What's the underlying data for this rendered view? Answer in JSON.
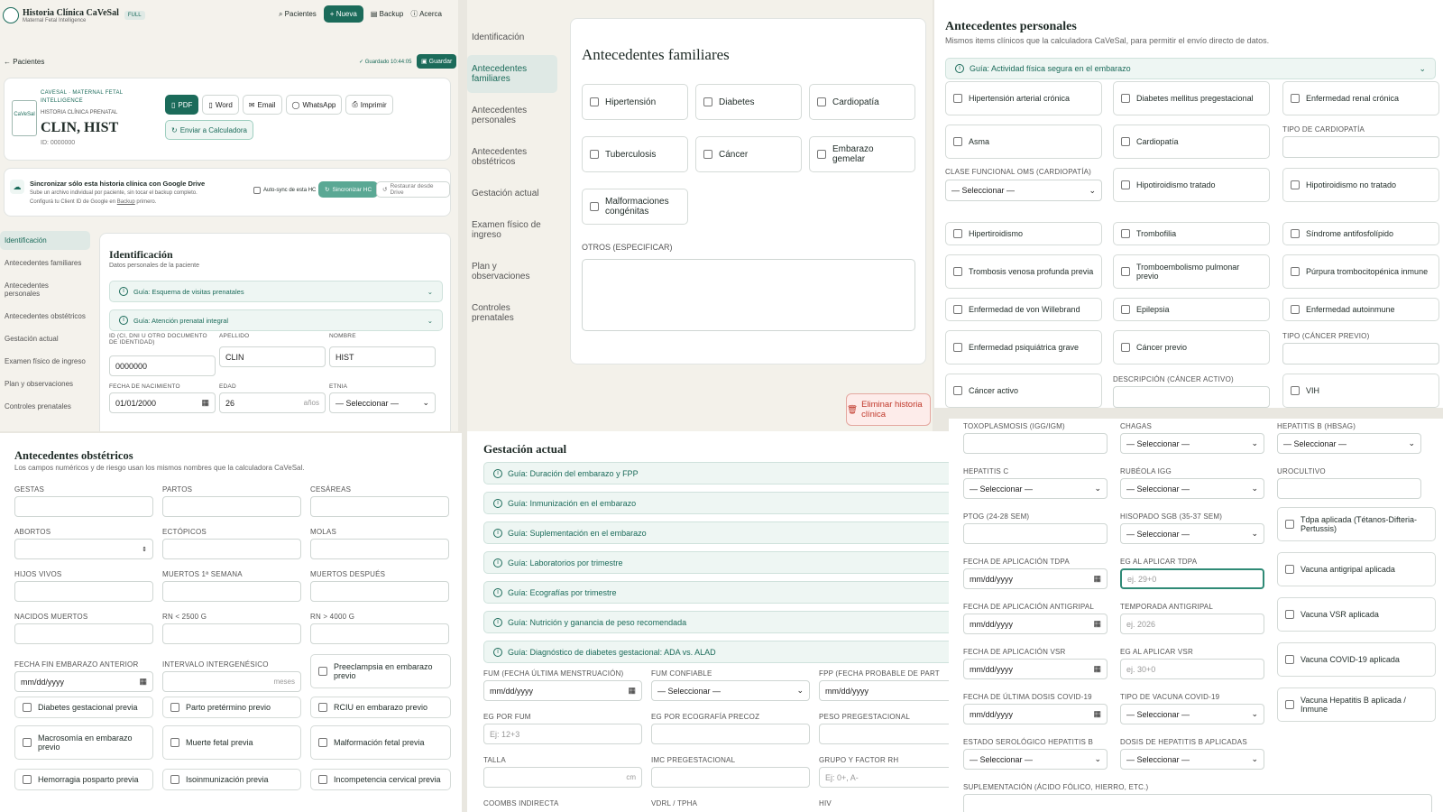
{
  "app": {
    "title": "Historia Clínica CaVeSal",
    "subtitle": "Maternal Fetal Intelligence",
    "badge": "FULL",
    "nav_pacientes": "Pacientes",
    "nav_nueva": "+ Nueva",
    "nav_backup": "Backup",
    "nav_acerca": "Acerca"
  },
  "p1": {
    "back": "Pacientes",
    "saved": "✓ Guardado 10:44:05",
    "save_btn": "Guardar",
    "card": {
      "org": "CAVESAL · MATERNAL FETAL INTELLIGENCE",
      "doc": "HISTORIA CLÍNICA PRENATAL",
      "name": "CLIN, HIST",
      "id": "ID: 0000000",
      "btn_pdf": "PDF",
      "btn_word": "Word",
      "btn_email": "Email",
      "btn_whatsapp": "WhatsApp",
      "btn_print": "Imprimir",
      "btn_send": "Enviar a Calculadora"
    },
    "sync": {
      "title": "Sincronizar sólo esta historia clínica con Google Drive",
      "desc": "Sube un archivo individual por paciente, sin tocar el backup completo.",
      "desc2a": "Configurá tu Client ID de Google en ",
      "desc2link": "Backup",
      "desc2b": " primero.",
      "autosync": "Auto-sync de esta HC",
      "sync_btn": "Sincronizar HC",
      "restore_btn": "Restaurar desde Drive"
    },
    "sidebar": [
      "Identificación",
      "Antecedentes familiares",
      "Antecedentes personales",
      "Antecedentes obstétricos",
      "Gestación actual",
      "Examen físico de ingreso",
      "Plan y observaciones",
      "Controles prenatales"
    ],
    "ident": {
      "title": "Identificación",
      "subtitle": "Datos personales de la paciente",
      "guide1": "Guía: Esquema de visitas prenatales",
      "guide2": "Guía: Atención prenatal integral",
      "id_label": "ID (CI, DNI U OTRO DOCUMENTO DE IDENTIDAD)",
      "id_value": "0000000",
      "apellido_label": "APELLIDO",
      "apellido_value": "CLIN",
      "nombre_label": "NOMBRE",
      "nombre_value": "HIST",
      "fnac_label": "FECHA DE NACIMIENTO",
      "fnac_value": "01/01/2000",
      "edad_label": "EDAD",
      "edad_value": "26",
      "edad_suffix": "años",
      "etnia_label": "ETNIA",
      "etnia_value": "— Seleccionar —"
    }
  },
  "p2": {
    "sidebar": [
      "Identificación",
      "Antecedentes familiares",
      "Antecedentes personales",
      "Antecedentes obstétricos",
      "Gestación actual",
      "Examen físico de ingreso",
      "Plan y observaciones",
      "Controles prenatales"
    ],
    "title": "Antecedentes familiares",
    "items": [
      "Hipertensión",
      "Diabetes",
      "Cardiopatía",
      "Tuberculosis",
      "Cáncer",
      "Embarazo gemelar",
      "Malformaciones congénitas"
    ],
    "otros_label": "OTROS (ESPECIFICAR)",
    "delete_btn": "Eliminar historia clínica"
  },
  "p3": {
    "title": "Antecedentes personales",
    "subtitle": "Mismos items clínicos que la calculadora CaVeSal, para permitir el envío directo de datos.",
    "guide": "Guía: Actividad física segura en el embarazo",
    "r1": [
      "Hipertensión arterial crónica",
      "Diabetes mellitus pregestacional",
      "Enfermedad renal crónica"
    ],
    "asma": "Asma",
    "cardiopatia": "Cardiopatía",
    "tipo_cardio_label": "TIPO DE CARDIOPATÍA",
    "clase_label": "CLASE FUNCIONAL OMS (CARDIOPATÍA)",
    "clase_value": "— Seleccionar —",
    "hipo_tratado": "Hipotiroidismo tratado",
    "hipo_no_tratado": "Hipotiroidismo no tratado",
    "r4": [
      "Hipertiroidismo",
      "Trombofilia",
      "Síndrome antifosfolípido"
    ],
    "r5": [
      "Trombosis venosa profunda previa",
      "Tromboembolismo pulmonar previo",
      "Púrpura trombocitopénica inmune"
    ],
    "r6": [
      "Enfermedad de von Willebrand",
      "Epilepsia",
      "Enfermedad autoinmune"
    ],
    "psiq": "Enfermedad psiquiátrica grave",
    "cancer_previo": "Cáncer previo",
    "tipo_cancer_label": "TIPO (CÁNCER PREVIO)",
    "cancer_activo": "Cáncer activo",
    "desc_cancer_label": "DESCRIPCIÓN (CÁNCER ACTIVO)",
    "vih": "VIH"
  },
  "p4": {
    "title": "Antecedentes obstétricos",
    "subtitle": "Los campos numéricos y de riesgo usan los mismos nombres que la calculadora CaVeSal.",
    "fields": [
      "GESTAS",
      "PARTOS",
      "CESÁREAS",
      "ABORTOS",
      "ECTÓPICOS",
      "MOLAS",
      "HIJOS VIVOS",
      "MUERTOS 1ª SEMANA",
      "MUERTOS DESPUÉS",
      "NACIDOS MUERTOS",
      "RN < 2500 G",
      "RN > 4000 G"
    ],
    "fecha_fin_label": "FECHA FIN EMBARAZO ANTERIOR",
    "fecha_fin_value": "mm/dd/yyyy",
    "intervalo_label": "INTERVALO INTERGENÉSICO",
    "intervalo_suffix": "meses",
    "preeclampsia": "Preeclampsia en embarazo previo",
    "c1": [
      "Diabetes gestacional previa",
      "Parto pretérmino previo",
      "RCIU en embarazo previo"
    ],
    "c2": [
      "Macrosomía en embarazo previo",
      "Muerte fetal previa",
      "Malformación fetal previa"
    ],
    "c3": [
      "Hemorragia posparto previa",
      "Isoinmunización previa",
      "Incompetencia cervical previa"
    ]
  },
  "p5": {
    "title": "Gestación actual",
    "guides": [
      "Guía: Duración del embarazo y FPP",
      "Guía: Inmunización en el embarazo",
      "Guía: Suplementación en el embarazo",
      "Guía: Laboratorios por trimestre",
      "Guía: Ecografías por trimestre",
      "Guía: Nutrición y ganancia de peso recomendada",
      "Guía: Diagnóstico de diabetes gestacional: ADA vs. ALAD"
    ],
    "fum_label": "FUM (FECHA ÚLTIMA MENSTRUACIÓN)",
    "fum_value": "mm/dd/yyyy",
    "fumc_label": "FUM CONFIABLE",
    "fumc_value": "— Seleccionar —",
    "fpp_label": "FPP (FECHA PROBABLE DE PART",
    "fpp_value": "mm/dd/yyyy",
    "egfum_label": "EG POR FUM",
    "egfum_ph": "Ej: 12+3",
    "egeco_label": "EG POR ECOGRAFÍA PRECOZ",
    "peso_label": "PESO PREGESTACIONAL",
    "talla_label": "TALLA",
    "talla_suffix": "cm",
    "imc_label": "IMC PREGESTACIONAL",
    "grupo_label": "GRUPO Y FACTOR RH",
    "grupo_ph": "Ej: 0+, A-",
    "coombs_label": "COOMBS INDIRECTA",
    "vdrl_label": "VDRL / TPHA",
    "hiv_label": "HIV"
  },
  "p6": {
    "toxo_label": "TOXOPLASMOSIS (IGG/IGM)",
    "chagas_label": "CHAGAS",
    "chagas_value": "— Seleccionar —",
    "hepb_label": "HEPATITIS B (HBSAG)",
    "hepb_value": "— Seleccionar —",
    "hepc_label": "HEPATITIS C",
    "hepc_value": "— Seleccionar —",
    "rubeola_label": "RUBÉOLA IGG",
    "rubeola_value": "— Seleccionar —",
    "urocultivo_label": "UROCULTIVO",
    "ptog_label": "PTOG (24-28 SEM)",
    "sgb_label": "HISOPADO SGB (35-37 SEM)",
    "sgb_value": "— Seleccionar —",
    "tdpa_chk": "Tdpa aplicada (Tétanos-Difteria-Pertussis)",
    "ftdpa_label": "FECHA DE APLICACIÓN TDPA",
    "ftdpa_value": "mm/dd/yyyy",
    "egtdpa_label": "EG AL APLICAR TDPA",
    "egtdpa_ph": "ej. 29+0",
    "antigripal_chk": "Vacuna antigripal aplicada",
    "fanti_label": "FECHA DE APLICACIÓN ANTIGRIPAL",
    "fanti_value": "mm/dd/yyyy",
    "temp_label": "TEMPORADA ANTIGRIPAL",
    "temp_ph": "ej. 2026",
    "vsr_chk": "Vacuna VSR aplicada",
    "fvsr_label": "FECHA DE APLICACIÓN VSR",
    "fvsr_value": "mm/dd/yyyy",
    "egvsr_label": "EG AL APLICAR VSR",
    "egvsr_ph": "ej. 30+0",
    "covid_chk": "Vacuna COVID-19 aplicada",
    "fcovid_label": "FECHA DE ÚLTIMA DOSIS COVID-19",
    "fcovid_value": "mm/dd/yyyy",
    "tipocovid_label": "TIPO DE VACUNA COVID-19",
    "tipocovid_value": "— Seleccionar —",
    "hepbvac_chk": "Vacuna Hepatitis B aplicada / Inmune",
    "estadohb_label": "ESTADO SEROLÓGICO HEPATITIS B",
    "estadohb_value": "— Seleccionar —",
    "dosishb_label": "DOSIS DE HEPATITIS B APLICADAS",
    "dosishb_value": "— Seleccionar —",
    "suplem_label": "SUPLEMENTACIÓN (ÁCIDO FÓLICO, HIERRO, ETC.)"
  },
  "colors": {
    "accent": "#1b6b5a",
    "danger": "#c0392b"
  }
}
